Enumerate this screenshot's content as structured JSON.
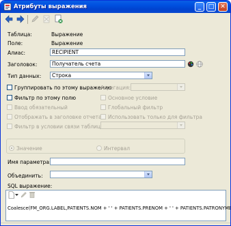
{
  "window": {
    "title": "Атрибуты выражения"
  },
  "fields": {
    "table_label": "Таблица:",
    "table_value": "Выражение",
    "field_label": "Поле:",
    "field_value": "Выражение",
    "alias_label": "Алиас:",
    "alias_value": "RECIPIENT",
    "header_label": "Заголовок:",
    "header_value": "Получатель счета",
    "datatype_label": "Тип данных:",
    "datatype_value": "Строка"
  },
  "options": {
    "group_by": "Группировать по этому выражению",
    "aggregation_label": "Агрегация:",
    "filter_by": "Фильтр по этому полю",
    "main_condition": "Основное условие",
    "required_input": "Ввод обязательный",
    "global_filter": "Глобальный фильтр",
    "show_in_header": "Отображать в заголовке отчета",
    "filter_only": "Использовать только для фильтра",
    "filter_in_link": "Фильтр в условии связи таблицы"
  },
  "mode": {
    "value_label": "Значение",
    "interval_label": "Интервал"
  },
  "param": {
    "name_label": "Имя параметра:",
    "combine_label": "Объединить:"
  },
  "sql": {
    "label": "SQL выражение:",
    "expression": "Coalesce(FM_ORG.LABEL,PATIENTS.NOM + ' ' + PATIENTS.PRENOM + ' ' + PATIENTS.PATRONYME)"
  }
}
